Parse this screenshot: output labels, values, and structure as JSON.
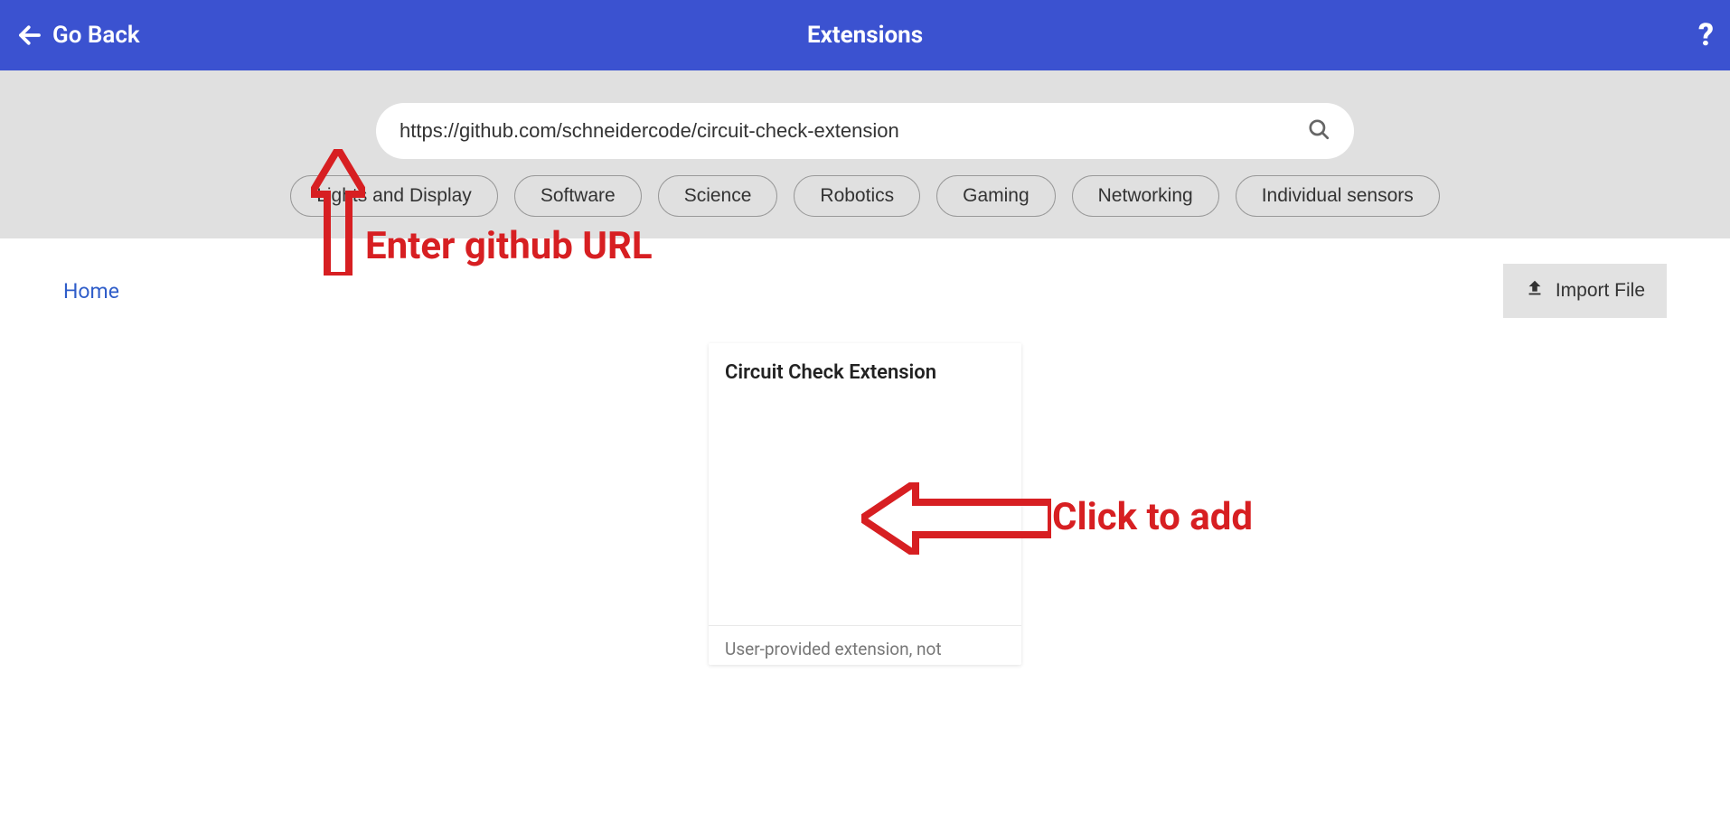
{
  "header": {
    "back_label": "Go Back",
    "title": "Extensions",
    "help": "?"
  },
  "search": {
    "value": "https://github.com/schneidercode/circuit-check-extension",
    "categories": [
      "Lights and Display",
      "Software",
      "Science",
      "Robotics",
      "Gaming",
      "Networking",
      "Individual sensors"
    ]
  },
  "content": {
    "breadcrumb": "Home",
    "import_label": "Import File",
    "card": {
      "title": "Circuit Check Extension",
      "description": "User-provided extension, not"
    }
  },
  "annotations": {
    "enter_url": "Enter github URL",
    "click_add": "Click to add"
  }
}
